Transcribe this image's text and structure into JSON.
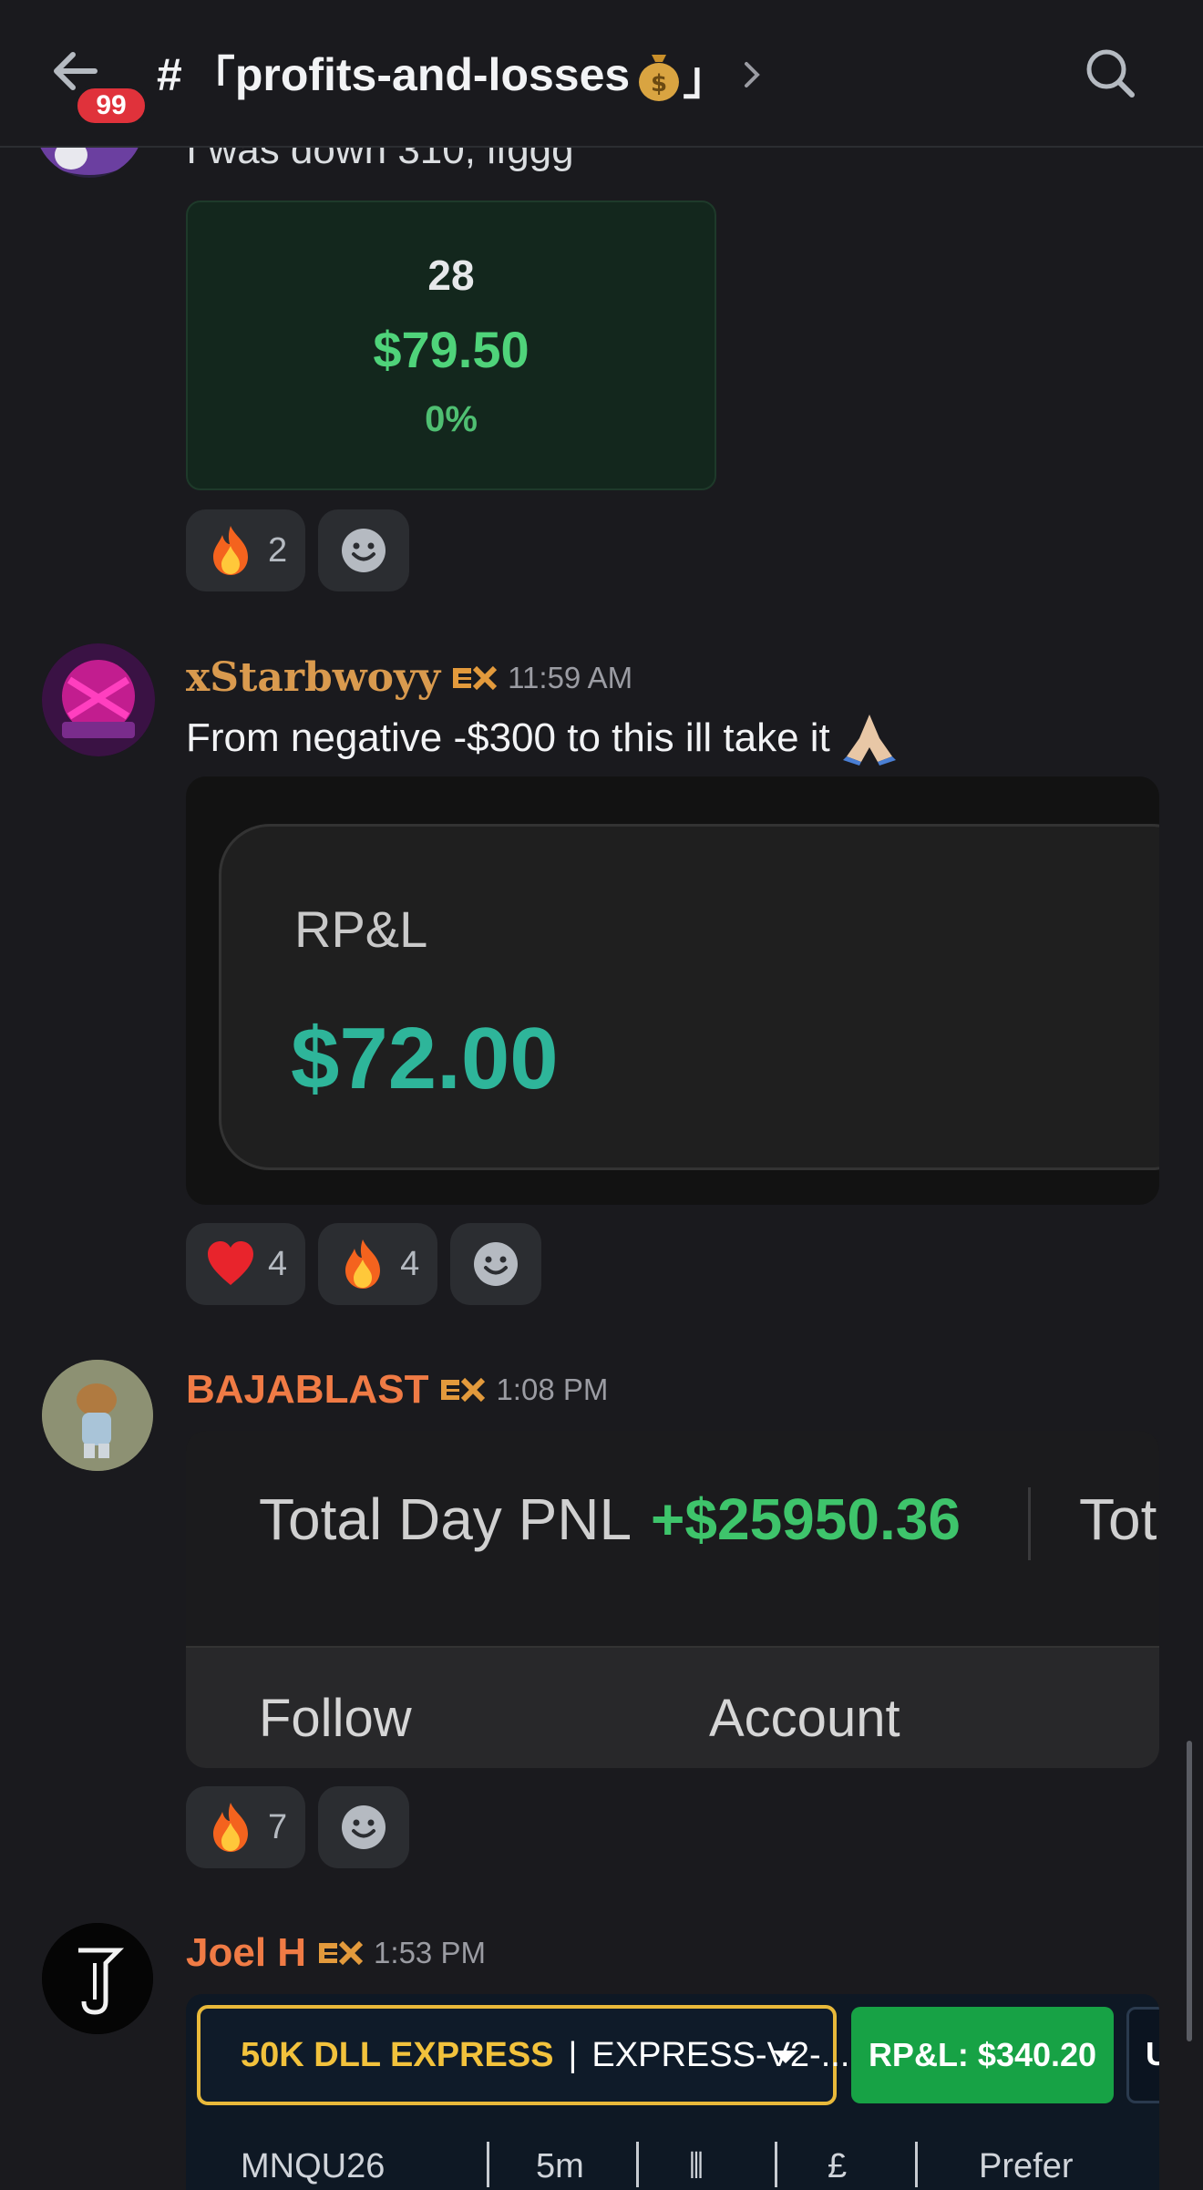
{
  "header": {
    "channel_name": "profits-and-losses",
    "channel_prefix": "#",
    "channel_open_bracket": "「",
    "channel_close_bracket": "」",
    "unread_count": "99"
  },
  "messages": [
    {
      "text": "I was down 310, lfggg",
      "attachment": {
        "count": "28",
        "amount": "$79.50",
        "percent": "0%"
      },
      "reactions": [
        {
          "emoji": "fire",
          "count": "2"
        }
      ]
    },
    {
      "username": "xStarbwoyy",
      "username_color": "#d99a4e",
      "timestamp": "11:59 AM",
      "text": "From negative -$300 to this ill take it",
      "attachment": {
        "label": "RP&L",
        "value": "$72.00"
      },
      "reactions": [
        {
          "emoji": "heart",
          "count": "4"
        },
        {
          "emoji": "fire",
          "count": "4"
        }
      ]
    },
    {
      "username": "BAJABLAST",
      "username_color": "#f07b45",
      "timestamp": "1:08 PM",
      "attachment": {
        "pnl_label": "Total Day PNL",
        "pnl_value": "+$25950.36",
        "pnl_cut": "Tot",
        "tab_follow": "Follow",
        "tab_account": "Account"
      },
      "reactions": [
        {
          "emoji": "fire",
          "count": "7"
        }
      ]
    },
    {
      "username": "Joel H",
      "username_color": "#f07b45",
      "timestamp": "1:53 PM",
      "attachment": {
        "account_name": "50K DLL EXPRESS",
        "account_separator": "|",
        "account_id": "EXPRESS-V2-...",
        "rpl_button": "RP&L: $340.20",
        "cut_button": "U",
        "toolbar": [
          "MNQU26",
          "5m",
          "£",
          "Prefer"
        ]
      }
    }
  ],
  "icons": {
    "back": "arrow-left-icon",
    "search": "magnifier-icon",
    "chevron": "chevron-right-icon",
    "money_bag": "money-bag-icon",
    "add_reaction": "smiley-add-icon",
    "role_badge": "ex-badge-icon"
  },
  "colors": {
    "background": "#1a1a1e",
    "badge": "#e0323b",
    "green_value": "#3ec46b",
    "teal_value": "#2eb59a",
    "select_border": "#e8b93a",
    "rpl_button": "#17a245"
  }
}
